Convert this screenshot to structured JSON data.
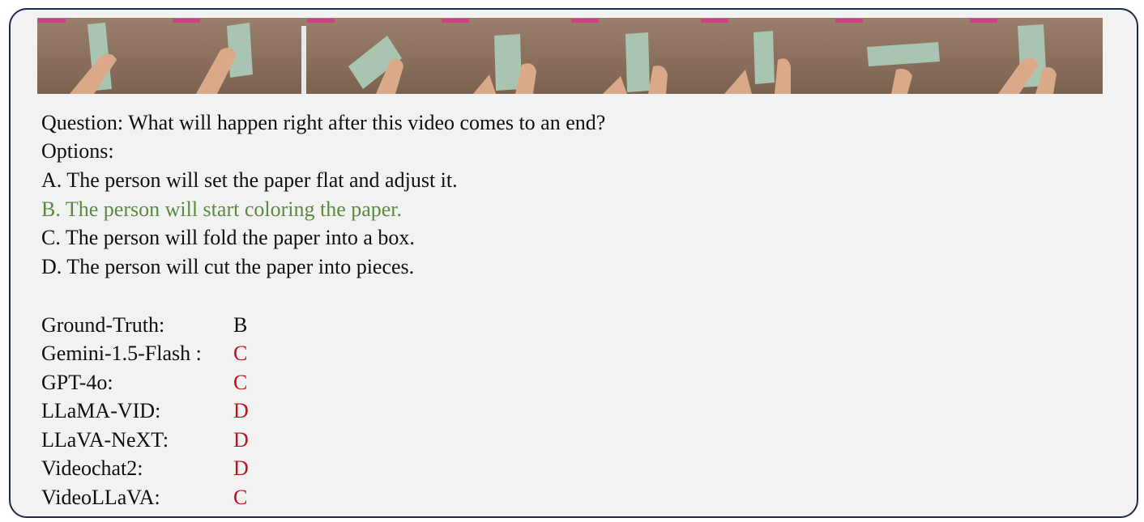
{
  "video_frames": [
    {
      "name": "frame-1"
    },
    {
      "name": "frame-2"
    },
    {
      "name": "frame-3"
    },
    {
      "name": "frame-4"
    },
    {
      "name": "frame-5"
    },
    {
      "name": "frame-6"
    },
    {
      "name": "frame-7"
    },
    {
      "name": "frame-8"
    }
  ],
  "question": "Question: What will happen right after this video comes to an end?",
  "options_label": "Options:",
  "options": [
    {
      "text": "A. The person will set the paper flat and adjust it."
    },
    {
      "text": "B. The person will start coloring the paper.",
      "correct": true
    },
    {
      "text": "C. The person will fold the paper into a box."
    },
    {
      "text": "D. The person will cut the paper into pieces."
    }
  ],
  "results": [
    {
      "model": "Ground-Truth:",
      "answer": "B",
      "color": "#0f0f0f"
    },
    {
      "model": "Gemini-1.5-Flash :",
      "answer": "C",
      "color": "#c0121e"
    },
    {
      "model": "GPT-4o:",
      "answer": "C",
      "color": "#c0121e"
    },
    {
      "model": "LLaMA-VID:",
      "answer": "D",
      "color": "#c0121e"
    },
    {
      "model": "LLaVA-NeXT:",
      "answer": "D",
      "color": "#c0121e"
    },
    {
      "model": "Videochat2:",
      "answer": "D",
      "color": "#c0121e"
    },
    {
      "model": "VideoLLaVA:",
      "answer": "C",
      "color": "#c0121e"
    }
  ],
  "colors": {
    "correct": "#5a8a3c",
    "wrong": "#c0121e",
    "border": "#1f2a4a",
    "panel": "#f2f2f2"
  }
}
